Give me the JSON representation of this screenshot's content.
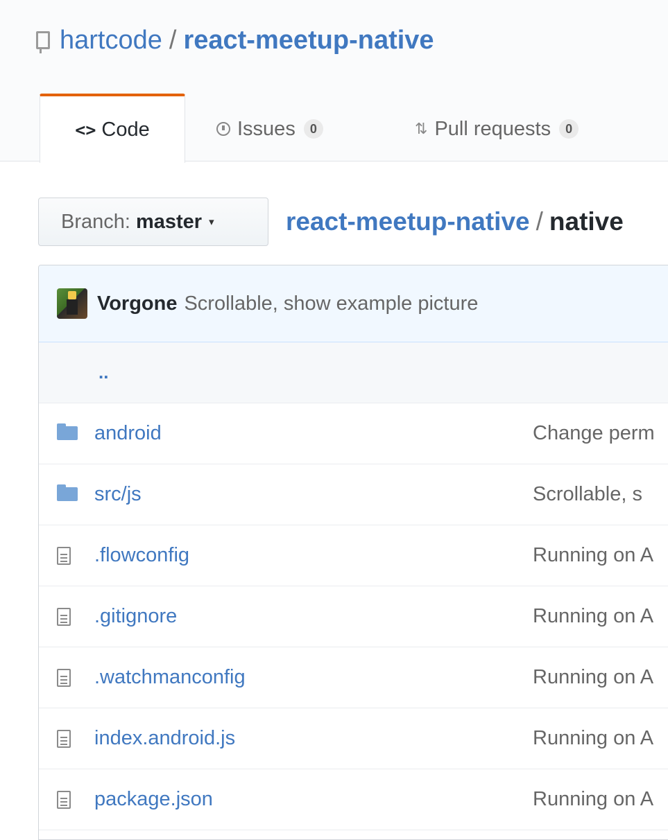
{
  "repo": {
    "owner": "hartcode",
    "separator": "/",
    "name": "react-meetup-native"
  },
  "tabs": {
    "code": {
      "icon": "<>",
      "label": "Code"
    },
    "issues": {
      "label": "Issues",
      "count": "0"
    },
    "pulls": {
      "label": "Pull requests",
      "count": "0"
    }
  },
  "branch": {
    "prefix": "Branch:",
    "name": "master",
    "caret": "▾"
  },
  "breadcrumb": {
    "root": "react-meetup-native",
    "separator": "/",
    "current": "native"
  },
  "commit": {
    "author": "Vorgone",
    "message": "Scrollable, show example picture"
  },
  "parent_link": "..",
  "files": [
    {
      "type": "folder",
      "name": "android",
      "message": "Change perm"
    },
    {
      "type": "folder",
      "name": "src/js",
      "message": "Scrollable, s"
    },
    {
      "type": "file",
      "name": ".flowconfig",
      "message": "Running on A"
    },
    {
      "type": "file",
      "name": ".gitignore",
      "message": "Running on A"
    },
    {
      "type": "file",
      "name": ".watchmanconfig",
      "message": "Running on A"
    },
    {
      "type": "file",
      "name": "index.android.js",
      "message": "Running on A"
    },
    {
      "type": "file",
      "name": "package.json",
      "message": "Running on A"
    }
  ],
  "colors": {
    "link": "#4078c0",
    "tab_accent": "#e36209",
    "commit_bar": "#f1f8ff",
    "folder": "#79a6d8"
  },
  "icons": {
    "repo": "repo-icon",
    "code": "code-icon",
    "issues": "issue-opened-icon",
    "pulls": "git-pull-request-icon",
    "folder": "folder-icon",
    "file": "file-text-icon"
  }
}
